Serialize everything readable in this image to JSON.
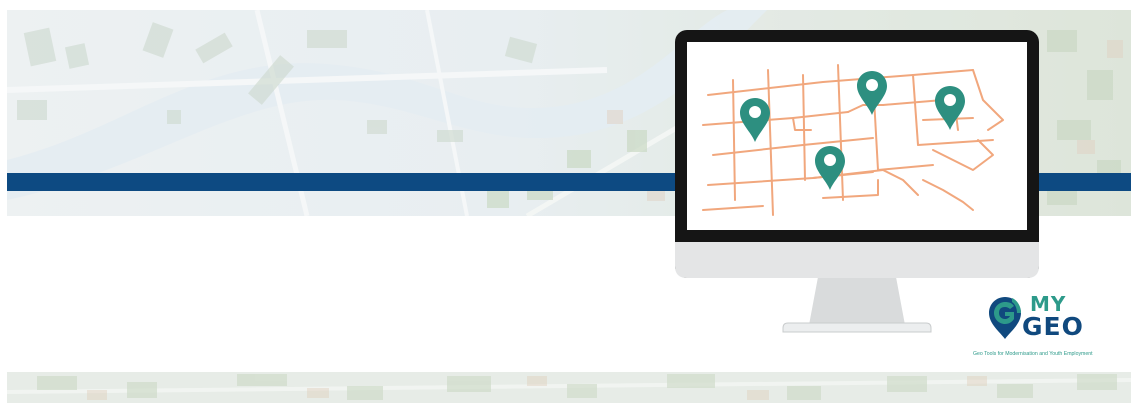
{
  "banner": {
    "band_color": "#0d4a82",
    "accent_color": "#2d8f80",
    "street_color": "#f1a77d"
  },
  "monitor": {
    "screen_icon": "street-map-icon",
    "pins": [
      "map-pin-icon",
      "map-pin-icon",
      "map-pin-icon",
      "map-pin-icon"
    ]
  },
  "logo": {
    "icon": "map-pin-g-icon",
    "line1": "MY",
    "line2": "GEO",
    "tagline": "Geo Tools for Modernisation and Youth Employment",
    "primary_color": "#10497e",
    "secondary_color": "#2d9a8a"
  }
}
